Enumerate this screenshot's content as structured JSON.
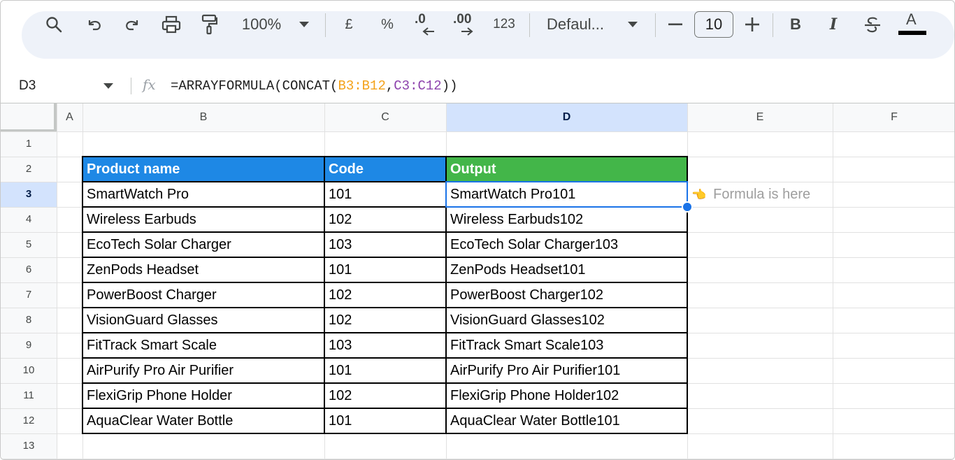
{
  "toolbar": {
    "zoom": "100%",
    "currency": "£",
    "percent": "%",
    "decrease_decimals": ".0",
    "increase_decimals": ".00",
    "more_formats": "123",
    "font": "Defaul...",
    "font_size": "10",
    "bold": "B",
    "italic": "I",
    "text_color_glyph": "A",
    "icons": [
      "search-icon",
      "undo-icon",
      "redo-icon",
      "print-icon",
      "paint-format-icon",
      "chevron-down-icon",
      "minus-icon",
      "plus-icon",
      "strikethrough-icon",
      "text-color-icon"
    ]
  },
  "formula_bar": {
    "name_box": "D3",
    "fx": "fx",
    "formula_prefix": "=ARRAYFORMULA(CONCAT(",
    "ref1": "B3:B12",
    "comma": ",",
    "ref2": "C3:C12",
    "formula_suffix": "))"
  },
  "columns": [
    "A",
    "B",
    "C",
    "D",
    "E",
    "F"
  ],
  "rows": [
    "1",
    "2",
    "3",
    "4",
    "5",
    "6",
    "7",
    "8",
    "9",
    "10",
    "11",
    "12",
    "13"
  ],
  "selected_cell": "D3",
  "table": {
    "headers": {
      "product": "Product name",
      "code": "Code",
      "output": "Output"
    },
    "header_colors": {
      "product": "#1e88e5",
      "code": "#1e88e5",
      "output": "#43b649"
    },
    "rows": [
      {
        "product": "SmartWatch Pro",
        "code": "101",
        "output": "SmartWatch Pro101"
      },
      {
        "product": "Wireless Earbuds",
        "code": "102",
        "output": "Wireless Earbuds102"
      },
      {
        "product": "EcoTech Solar Charger",
        "code": "103",
        "output": "EcoTech Solar Charger103"
      },
      {
        "product": "ZenPods Headset",
        "code": "101",
        "output": "ZenPods Headset101"
      },
      {
        "product": "PowerBoost Charger",
        "code": "102",
        "output": "PowerBoost Charger102"
      },
      {
        "product": "VisionGuard Glasses",
        "code": "102",
        "output": "VisionGuard Glasses102"
      },
      {
        "product": "FitTrack Smart Scale",
        "code": "103",
        "output": "FitTrack Smart Scale103"
      },
      {
        "product": "AirPurify Pro Air Purifier",
        "code": "101",
        "output": "AirPurify Pro Air Purifier101"
      },
      {
        "product": "FlexiGrip Phone Holder",
        "code": "102",
        "output": "FlexiGrip Phone Holder102"
      },
      {
        "product": "AquaClear Water Bottle",
        "code": "101",
        "output": "AquaClear Water Bottle101"
      }
    ]
  },
  "annotation": {
    "emoji": "👈",
    "text": "Formula is here"
  }
}
